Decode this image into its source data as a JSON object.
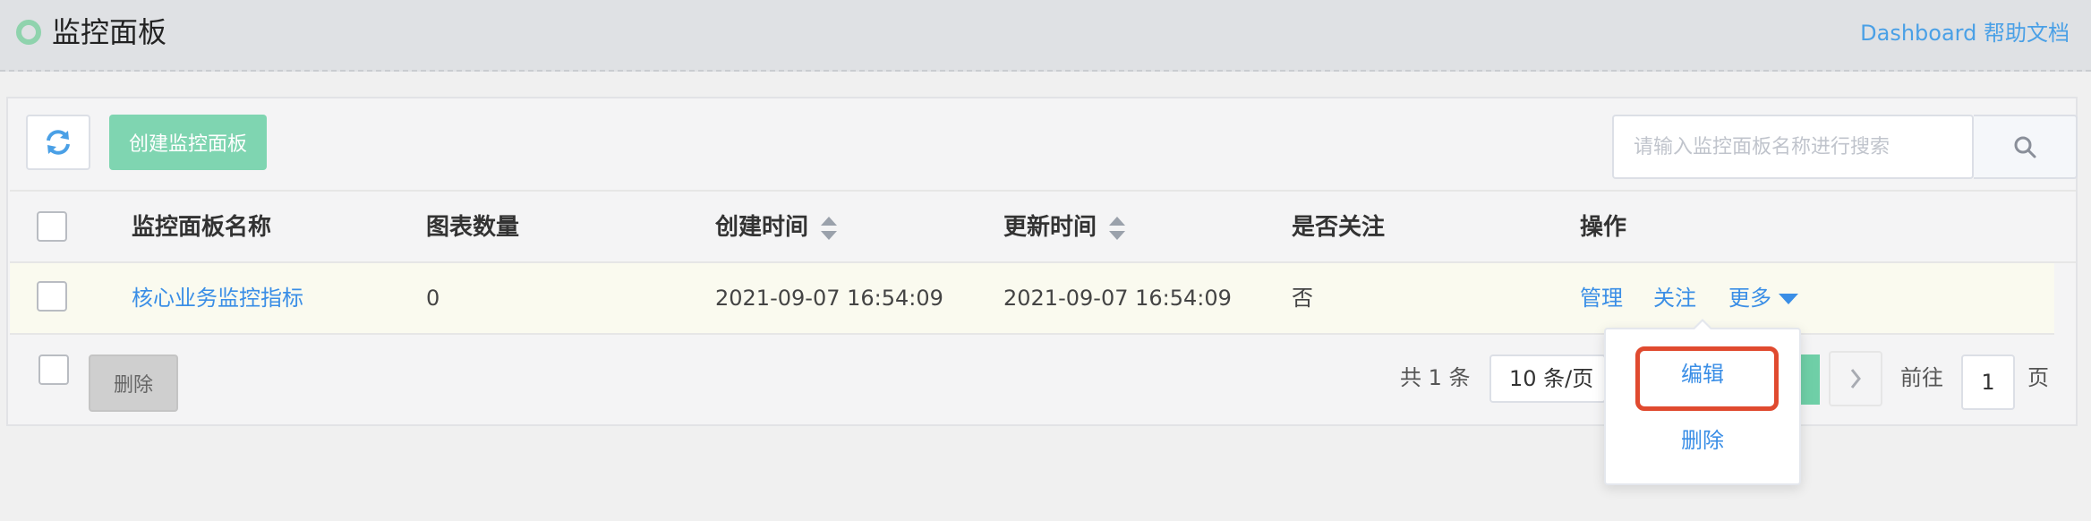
{
  "header": {
    "title": "监控面板",
    "help_link": "Dashboard 帮助文档"
  },
  "toolbar": {
    "refresh_icon": "refresh-icon",
    "create_label": "创建监控面板",
    "search_placeholder": "请输入监控面板名称进行搜索",
    "search_icon": "search-icon"
  },
  "table": {
    "columns": [
      "监控面板名称",
      "图表数量",
      "创建时间",
      "更新时间",
      "是否关注",
      "操作"
    ],
    "rows": [
      {
        "name": "核心业务监控指标",
        "chart_count": "0",
        "created": "2021-09-07 16:54:09",
        "updated": "2021-09-07 16:54:09",
        "followed": "否",
        "actions": [
          "管理",
          "关注",
          "更多"
        ]
      }
    ]
  },
  "footer": {
    "delete_label": "删除",
    "total": "共 1 条",
    "page_size": "10 条/页",
    "goto_label": "前往",
    "goto_value": "1",
    "page_suffix": "页"
  },
  "dropdown": {
    "items": [
      "编辑",
      "删除"
    ]
  },
  "colors": {
    "accent": "#3a8ee6",
    "primary_button": "#7fd5b1",
    "highlight": "#e04a2f",
    "row_hover": "#fafaef"
  }
}
